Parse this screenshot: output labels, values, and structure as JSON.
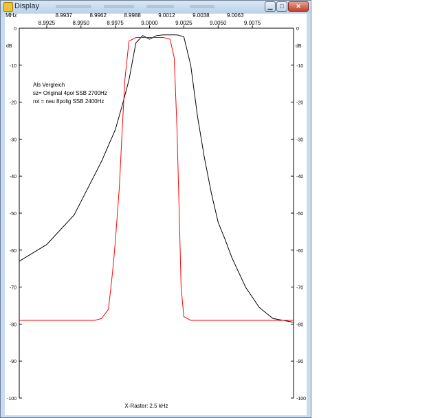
{
  "window": {
    "title": "Display",
    "buttons": {
      "minimize": "▁",
      "maximize": "□",
      "close": "✕"
    }
  },
  "colors": {
    "series_black": "#000000",
    "series_red": "#ff0000",
    "axis": "#000000"
  },
  "chart_data": {
    "type": "line",
    "xlabel": "X-Raster: 2.5 kHz",
    "x_unit": "MHz",
    "y_unit": "dB",
    "xlim": [
      8.9905,
      9.0105
    ],
    "ylim": [
      -100,
      0
    ],
    "x_ticks": [
      "8.9925",
      "8.9950",
      "8.9975",
      "9.0000",
      "9.0025",
      "9.0050",
      "9.0075"
    ],
    "y_ticks": [
      "0",
      "-10",
      "-20",
      "-30",
      "-40",
      "-50",
      "-60",
      "-70",
      "-80",
      "-90",
      "-100"
    ],
    "grid": false,
    "annotation": [
      "Als Vergleich",
      "sz= Original 4pol SSB 2700Hz",
      "rot = neu 8polig SSB 2400Hz"
    ],
    "series": [
      {
        "color": "black",
        "x": [
          8.9905,
          8.9925,
          8.9945,
          8.9965,
          8.9975,
          8.998,
          8.9985,
          8.999,
          8.9995,
          9.0,
          9.0005,
          9.001,
          9.0015,
          9.002,
          9.0025,
          9.003,
          9.0035,
          9.004,
          9.0045,
          9.005,
          9.0055,
          9.006,
          9.007,
          9.008,
          9.009,
          9.0105
        ],
        "y": [
          -63,
          -58.5,
          -50.5,
          -36,
          -27.5,
          -21,
          -14,
          -4,
          -2,
          -3,
          -2,
          -1.8,
          -1.8,
          -1.8,
          -2.3,
          -10,
          -24,
          -35,
          -44.5,
          -52.5,
          -57,
          -62,
          -70,
          -75.5,
          -78.5,
          -79.5
        ]
      },
      {
        "color": "red",
        "x": [
          8.9905,
          8.996,
          8.9965,
          8.997,
          8.9973,
          8.9975,
          8.9978,
          8.998,
          8.9982,
          8.9985,
          8.999,
          9.0,
          9.001,
          9.0015,
          9.0018,
          9.002,
          9.0022,
          9.0023,
          9.0025,
          9.003,
          9.005,
          9.0105
        ],
        "y": [
          -79,
          -79,
          -78.5,
          -76,
          -66,
          -58,
          -43,
          -28,
          -14,
          -3.5,
          -2.5,
          -2.5,
          -2.5,
          -3,
          -8,
          -27,
          -55,
          -70,
          -78,
          -79,
          -79,
          -79
        ]
      }
    ]
  }
}
